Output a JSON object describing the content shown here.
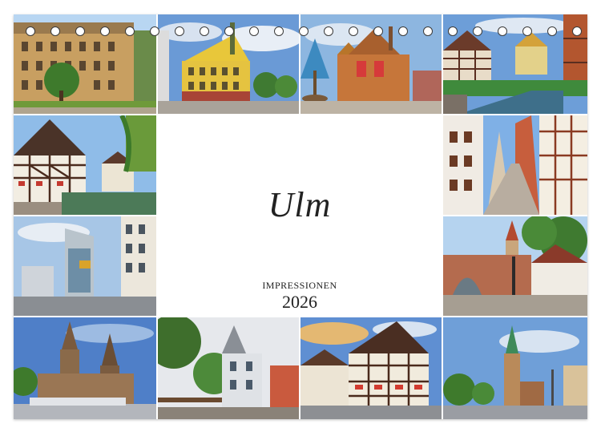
{
  "calendar": {
    "title": "Ulm",
    "subtitle": "IMPRESSIONEN",
    "year": "2026"
  },
  "photos": [
    "photo-palace-tree",
    "photo-yellow-townhall",
    "photo-painted-rathaus",
    "photo-half-timber-canal",
    "photo-half-timber-river",
    "photo-old-town-street",
    "photo-modern-buildings",
    "photo-gate-fountain",
    "photo-minster",
    "photo-stepped-gable",
    "photo-crooked-house",
    "photo-church-tower"
  ],
  "colors": {
    "sky": "#5b8fd6",
    "frame_bg": "#ffffff",
    "text": "#222222"
  }
}
